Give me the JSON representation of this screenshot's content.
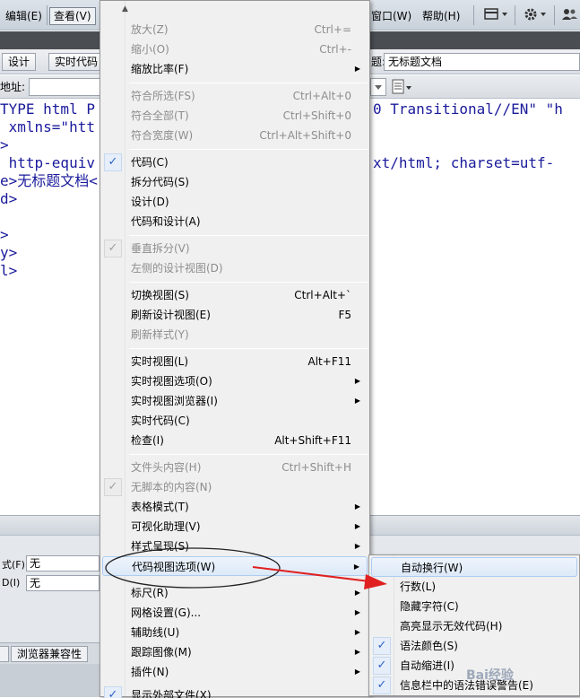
{
  "menubar": {
    "items": [
      {
        "label": "编辑(E)"
      },
      {
        "label": "查看(V)"
      },
      {
        "label": "窗口(W)"
      },
      {
        "label": "帮助(H)"
      }
    ],
    "layout_icon": "layout-icon",
    "gear_icon": "gear-icon",
    "people_icon": "people-icon"
  },
  "toolbar": {
    "design_label": "设计",
    "live_code_label": "实时代码",
    "title_label": "题:",
    "title_value": "无标题文档"
  },
  "address": {
    "label": "地址:"
  },
  "code_lines": {
    "l1a": "TYPE html P",
    "l1b": "0 Transitional//EN\" \"h",
    "l2": " xmlns=\"htt",
    "l3": ">",
    "l4a": " http-equiv",
    "l4b": "xt/html; charset=utf-",
    "l5": "e>无标题文档<",
    "l6": "d>",
    "l7": ">",
    "l8": "y>",
    "l9": "l>"
  },
  "properties": {
    "format_label": "式(F)",
    "format_value": "无",
    "id_label": "D(I)",
    "id_value": "无"
  },
  "panel_tabs": {
    "browser_compat": "浏览器兼容性"
  },
  "menu": {
    "zoom_in": {
      "label": "放大(Z)",
      "shortcut": "Ctrl+="
    },
    "zoom_out": {
      "label": "缩小(O)",
      "shortcut": "Ctrl+-"
    },
    "zoom_ratio": {
      "label": "缩放比率(F)"
    },
    "fit_selection": {
      "label": "符合所选(FS)",
      "shortcut": "Ctrl+Alt+0"
    },
    "fit_all": {
      "label": "符合全部(T)",
      "shortcut": "Ctrl+Shift+0"
    },
    "fit_width": {
      "label": "符合宽度(W)",
      "shortcut": "Ctrl+Alt+Shift+0"
    },
    "code": {
      "label": "代码(C)"
    },
    "split_code": {
      "label": "拆分代码(S)"
    },
    "design": {
      "label": "设计(D)"
    },
    "code_and_design": {
      "label": "代码和设计(A)"
    },
    "vertical_split": {
      "label": "垂直拆分(V)"
    },
    "design_on_left": {
      "label": "左侧的设计视图(D)"
    },
    "switch_views": {
      "label": "切换视图(S)",
      "shortcut": "Ctrl+Alt+`"
    },
    "refresh_design": {
      "label": "刷新设计视图(E)",
      "shortcut": "F5"
    },
    "refresh_styles": {
      "label": "刷新样式(Y)"
    },
    "live_view": {
      "label": "实时视图(L)",
      "shortcut": "Alt+F11"
    },
    "live_view_options": {
      "label": "实时视图选项(O)"
    },
    "live_view_browser": {
      "label": "实时视图浏览器(I)"
    },
    "live_code": {
      "label": "实时代码(C)"
    },
    "inspect": {
      "label": "检查(I)",
      "shortcut": "Alt+Shift+F11"
    },
    "head_content": {
      "label": "文件头内容(H)",
      "shortcut": "Ctrl+Shift+H"
    },
    "noscript_content": {
      "label": "无脚本的内容(N)"
    },
    "table_mode": {
      "label": "表格模式(T)"
    },
    "visual_aids": {
      "label": "可视化助理(V)"
    },
    "style_rendering": {
      "label": "样式呈现(S)"
    },
    "code_view_options": {
      "label": "代码视图选项(W)"
    },
    "rulers": {
      "label": "标尺(R)"
    },
    "grid": {
      "label": "网格设置(G)..."
    },
    "guides": {
      "label": "辅助线(U)"
    },
    "tracing_image": {
      "label": "跟踪图像(M)"
    },
    "plugins": {
      "label": "插件(N)"
    },
    "show_external": {
      "label": "显示外部文件(X)"
    }
  },
  "submenu": {
    "word_wrap": {
      "label": "自动换行(W)"
    },
    "line_numbers": {
      "label": "行数(L)"
    },
    "hidden_chars": {
      "label": "隐藏字符(C)"
    },
    "highlight_invalid": {
      "label": "高亮显示无效代码(H)"
    },
    "syntax_coloring": {
      "label": "语法颜色(S)"
    },
    "auto_indent": {
      "label": "自动缩进(I)"
    },
    "info_bar_errors": {
      "label": "信息栏中的语法错误警告(E)"
    }
  },
  "check_glyph": "✓",
  "arrow_glyph": "▶",
  "colors": {
    "accent": "#2e64c5",
    "annotation_red": "#e02020",
    "code_blue": "#1a1a9c"
  }
}
